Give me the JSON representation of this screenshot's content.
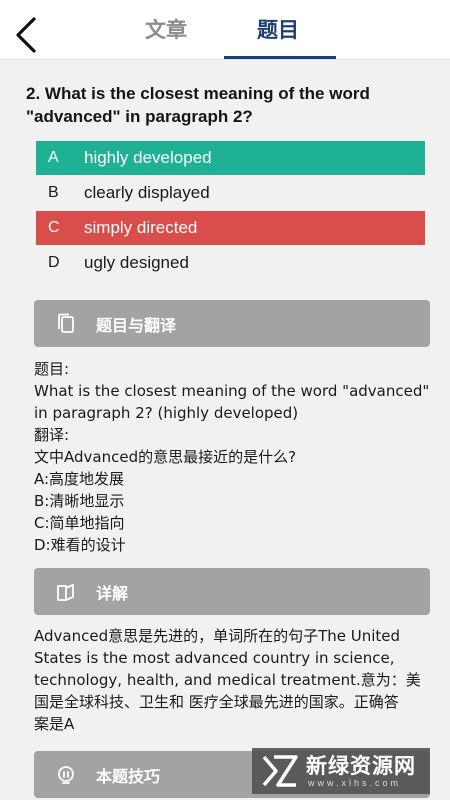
{
  "header": {
    "tabs": [
      {
        "label": "文章",
        "active": false
      },
      {
        "label": "题目",
        "active": true
      }
    ],
    "active_color": "#1f3f74",
    "inactive_color": "#8c8c8c",
    "back_icon": "chevron-left-icon"
  },
  "question": {
    "text": "2. What is the closest meaning of the word \"advanced\" in paragraph 2?",
    "options": [
      {
        "letter": "A",
        "text": "highly developed",
        "state": "correct"
      },
      {
        "letter": "B",
        "text": "clearly displayed",
        "state": "normal"
      },
      {
        "letter": "C",
        "text": "simply directed",
        "state": "wrong"
      },
      {
        "letter": "D",
        "text": "ugly designed",
        "state": "normal"
      }
    ],
    "correct_color": "#1fb195",
    "wrong_color": "#d94d4a"
  },
  "sections": {
    "translation": {
      "title": "题目与翻译",
      "icon": "copy-icon",
      "lines": [
        "题目:",
        "What is the closest meaning of the word \"advanced\"",
        "in paragraph 2? (highly developed)",
        "翻译:",
        "文中Advanced的意思最接近的是什么?",
        "A:高度地发展",
        "B:清晰地显示",
        "C:简单地指向",
        "D:难看的设计"
      ]
    },
    "detail": {
      "title": "详解",
      "icon": "book-open-icon",
      "lines": [
        "Advanced意思是先进的，单词所在的句子The United",
        "States is the most advanced country in science,",
        "technology, health, and medical treatment.意为：美",
        "国是全球科技、卫生和 医疗全球最先进的国家。正确答",
        "案是A"
      ]
    },
    "tips": {
      "title": "本题技巧",
      "icon": "lightbulb-icon"
    },
    "bar_color": "#a3a3a3"
  },
  "watermark": {
    "text": "新绿资源网",
    "url": "www.xlhs.com"
  }
}
